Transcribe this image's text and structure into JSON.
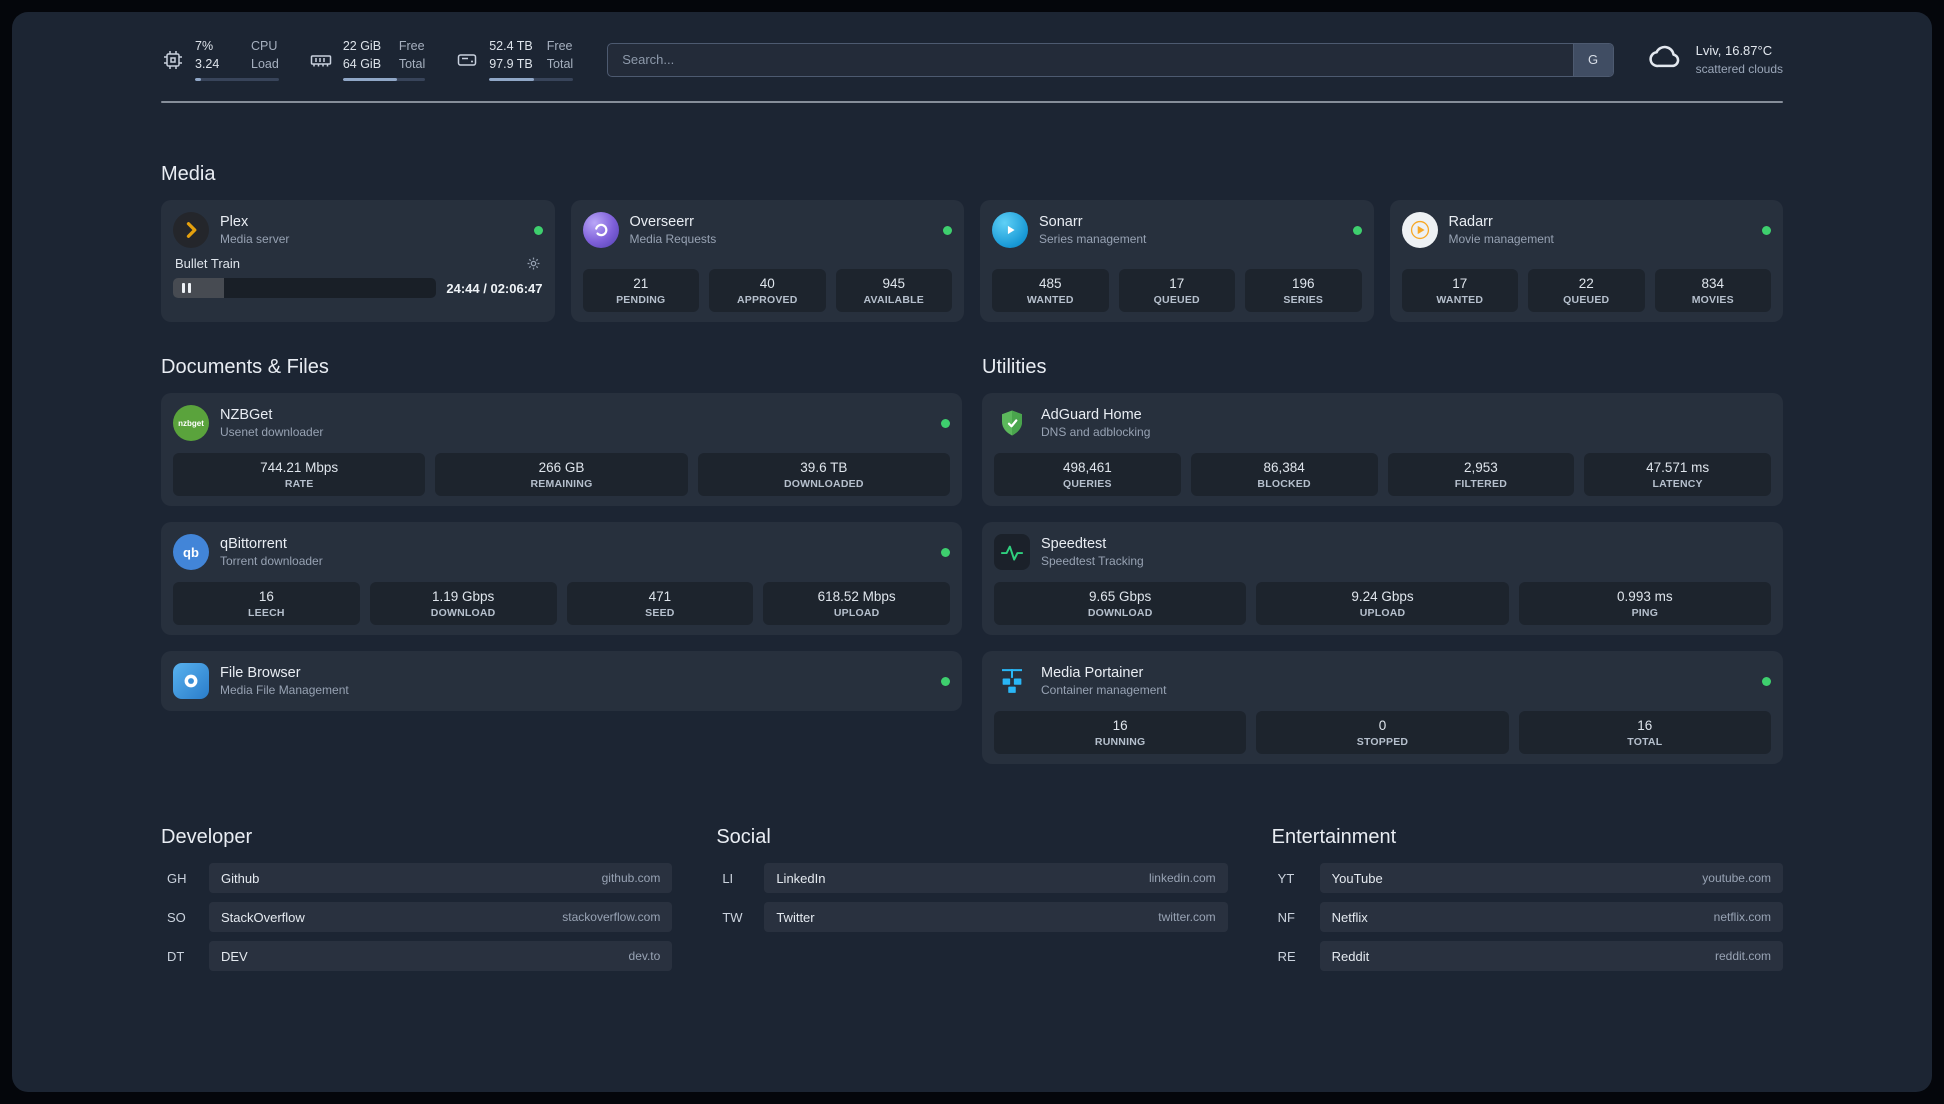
{
  "topbar": {
    "resources": [
      {
        "v1": "7%",
        "l1": "CPU",
        "v2": "3.24",
        "l2": "Load",
        "progress": 7
      },
      {
        "v1": "22 GiB",
        "l1": "Free",
        "v2": "64 GiB",
        "l2": "Total",
        "progress": 66
      },
      {
        "v1": "52.4 TB",
        "l1": "Free",
        "v2": "97.9 TB",
        "l2": "Total",
        "progress": 53
      }
    ],
    "search": {
      "placeholder": "Search...",
      "button_label": "G"
    },
    "weather": {
      "location": "Lviv, 16.87°C",
      "condition": "scattered clouds"
    }
  },
  "sections": {
    "media": {
      "title": "Media",
      "cards": [
        {
          "name": "Plex",
          "subtitle": "Media server",
          "status": "online",
          "player": {
            "track": "Bullet Train",
            "time": "24:44 / 02:06:47",
            "progress": 19.4
          }
        },
        {
          "name": "Overseerr",
          "subtitle": "Media Requests",
          "status": "online",
          "stats": [
            {
              "value": "21",
              "label": "PENDING"
            },
            {
              "value": "40",
              "label": "APPROVED"
            },
            {
              "value": "945",
              "label": "AVAILABLE"
            }
          ]
        },
        {
          "name": "Sonarr",
          "subtitle": "Series management",
          "status": "online",
          "stats": [
            {
              "value": "485",
              "label": "WANTED"
            },
            {
              "value": "17",
              "label": "QUEUED"
            },
            {
              "value": "196",
              "label": "SERIES"
            }
          ]
        },
        {
          "name": "Radarr",
          "subtitle": "Movie management",
          "status": "online",
          "stats": [
            {
              "value": "17",
              "label": "WANTED"
            },
            {
              "value": "22",
              "label": "QUEUED"
            },
            {
              "value": "834",
              "label": "MOVIES"
            }
          ]
        }
      ]
    },
    "documents": {
      "title": "Documents & Files",
      "cards": [
        {
          "name": "NZBGet",
          "subtitle": "Usenet downloader",
          "status": "online",
          "icon_text": "nzbget",
          "stats": [
            {
              "value": "744.21 Mbps",
              "label": "RATE"
            },
            {
              "value": "266 GB",
              "label": "REMAINING"
            },
            {
              "value": "39.6 TB",
              "label": "DOWNLOADED"
            }
          ]
        },
        {
          "name": "qBittorrent",
          "subtitle": "Torrent downloader",
          "status": "online",
          "icon_text": "qb",
          "stats": [
            {
              "value": "16",
              "label": "LEECH"
            },
            {
              "value": "1.19 Gbps",
              "label": "DOWNLOAD"
            },
            {
              "value": "471",
              "label": "SEED"
            },
            {
              "value": "618.52 Mbps",
              "label": "UPLOAD"
            }
          ]
        },
        {
          "name": "File Browser",
          "subtitle": "Media File Management",
          "status": "online"
        }
      ]
    },
    "utilities": {
      "title": "Utilities",
      "cards": [
        {
          "name": "AdGuard Home",
          "subtitle": "DNS and adblocking",
          "stats": [
            {
              "value": "498,461",
              "label": "QUERIES"
            },
            {
              "value": "86,384",
              "label": "BLOCKED"
            },
            {
              "value": "2,953",
              "label": "FILTERED"
            },
            {
              "value": "47.571 ms",
              "label": "LATENCY"
            }
          ]
        },
        {
          "name": "Speedtest",
          "subtitle": "Speedtest Tracking",
          "stats": [
            {
              "value": "9.65 Gbps",
              "label": "DOWNLOAD"
            },
            {
              "value": "9.24 Gbps",
              "label": "UPLOAD"
            },
            {
              "value": "0.993 ms",
              "label": "PING"
            }
          ]
        },
        {
          "name": "Media Portainer",
          "subtitle": "Container management",
          "status": "online",
          "stats": [
            {
              "value": "16",
              "label": "RUNNING"
            },
            {
              "value": "0",
              "label": "STOPPED"
            },
            {
              "value": "16",
              "label": "TOTAL"
            }
          ]
        }
      ]
    }
  },
  "bookmarks": {
    "groups": [
      {
        "title": "Developer",
        "items": [
          {
            "abbr": "GH",
            "name": "Github",
            "domain": "github.com"
          },
          {
            "abbr": "SO",
            "name": "StackOverflow",
            "domain": "stackoverflow.com"
          },
          {
            "abbr": "DT",
            "name": "DEV",
            "domain": "dev.to"
          }
        ]
      },
      {
        "title": "Social",
        "items": [
          {
            "abbr": "LI",
            "name": "LinkedIn",
            "domain": "linkedin.com"
          },
          {
            "abbr": "TW",
            "name": "Twitter",
            "domain": "twitter.com"
          }
        ]
      },
      {
        "title": "Entertainment",
        "items": [
          {
            "abbr": "YT",
            "name": "YouTube",
            "domain": "youtube.com"
          },
          {
            "abbr": "NF",
            "name": "Netflix",
            "domain": "netflix.com"
          },
          {
            "abbr": "RE",
            "name": "Reddit",
            "domain": "reddit.com"
          }
        ]
      }
    ]
  },
  "colors": {
    "status_online": "#3ecf6e",
    "background": "#1c2533",
    "accent": "#90a7c7"
  }
}
